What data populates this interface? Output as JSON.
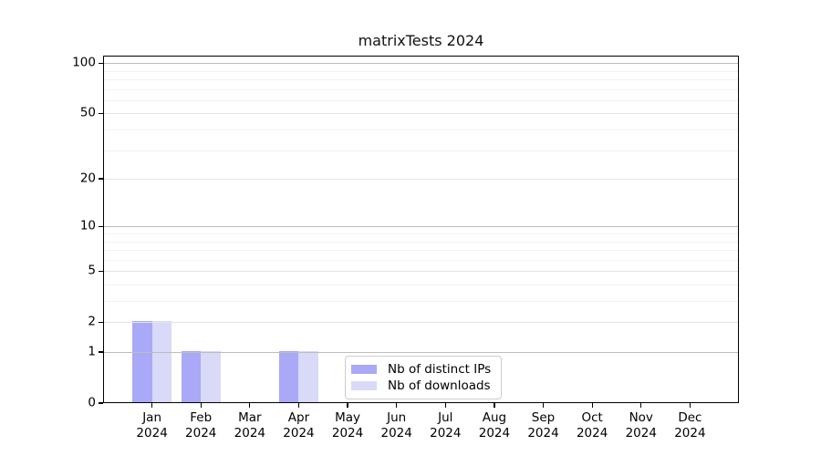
{
  "chart_data": {
    "type": "bar",
    "title": "matrixTests 2024",
    "x_categories": [
      "Jan",
      "Feb",
      "Mar",
      "Apr",
      "May",
      "Jun",
      "Jul",
      "Aug",
      "Sep",
      "Oct",
      "Nov",
      "Dec"
    ],
    "x_year_label": "2024",
    "series": [
      {
        "name": "Nb of distinct IPs",
        "color": "#a9a9f7",
        "values": [
          2,
          1,
          0,
          1,
          0,
          0,
          0,
          0,
          0,
          0,
          0,
          0
        ]
      },
      {
        "name": "Nb of downloads",
        "color": "#d9d9f8",
        "values": [
          2,
          1,
          0,
          1,
          0,
          0,
          0,
          0,
          0,
          0,
          0,
          0
        ]
      }
    ],
    "y_scale": "log1p",
    "ylim": [
      0,
      100
    ],
    "y_tick_values": [
      0,
      1,
      2,
      5,
      10,
      20,
      50,
      100
    ],
    "y_minor_tick_values": [
      3,
      4,
      6,
      7,
      8,
      9,
      30,
      40,
      60,
      70,
      80,
      90
    ],
    "grid": true,
    "legend_position": "lower center inside"
  }
}
